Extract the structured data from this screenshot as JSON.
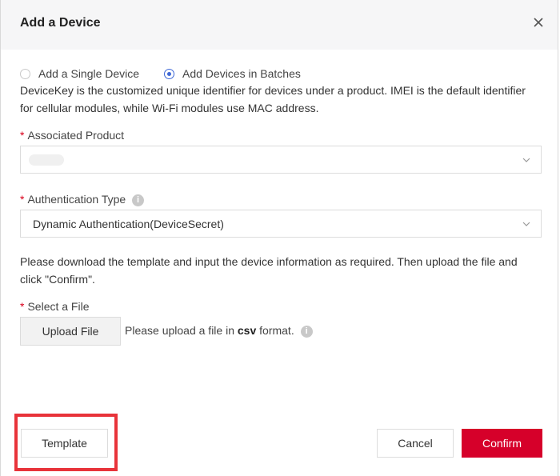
{
  "dialog": {
    "title": "Add a Device"
  },
  "mode": {
    "options": [
      {
        "label": "Add a Single Device",
        "selected": false
      },
      {
        "label": "Add Devices in Batches",
        "selected": true
      }
    ],
    "description": "DeviceKey is the customized unique identifier for devices under a product. IMEI is the default identifier for cellular modules, while Wi-Fi modules use MAC address."
  },
  "fields": {
    "product": {
      "required_mark": "*",
      "label": "Associated Product",
      "value": ""
    },
    "auth": {
      "required_mark": "*",
      "label": "Authentication Type",
      "value": "Dynamic Authentication(DeviceSecret)"
    },
    "instructions": "Please download the template and input the device information as required. Then upload the file and click \"Confirm\".",
    "file": {
      "required_mark": "*",
      "label": "Select a File",
      "upload_label": "Upload File",
      "hint_prefix": "Please upload a file in",
      "hint_format": "csv",
      "hint_suffix": "format."
    }
  },
  "footer": {
    "template_label": "Template",
    "cancel_label": "Cancel",
    "confirm_label": "Confirm"
  },
  "colors": {
    "accent_blue": "#3d67d6",
    "confirm_red": "#d6002a",
    "highlight_red": "#e8333a",
    "required_red": "#d9001b"
  },
  "icons": {
    "close": "close-icon",
    "chevron": "chevron-down-icon",
    "info": "info-icon"
  }
}
